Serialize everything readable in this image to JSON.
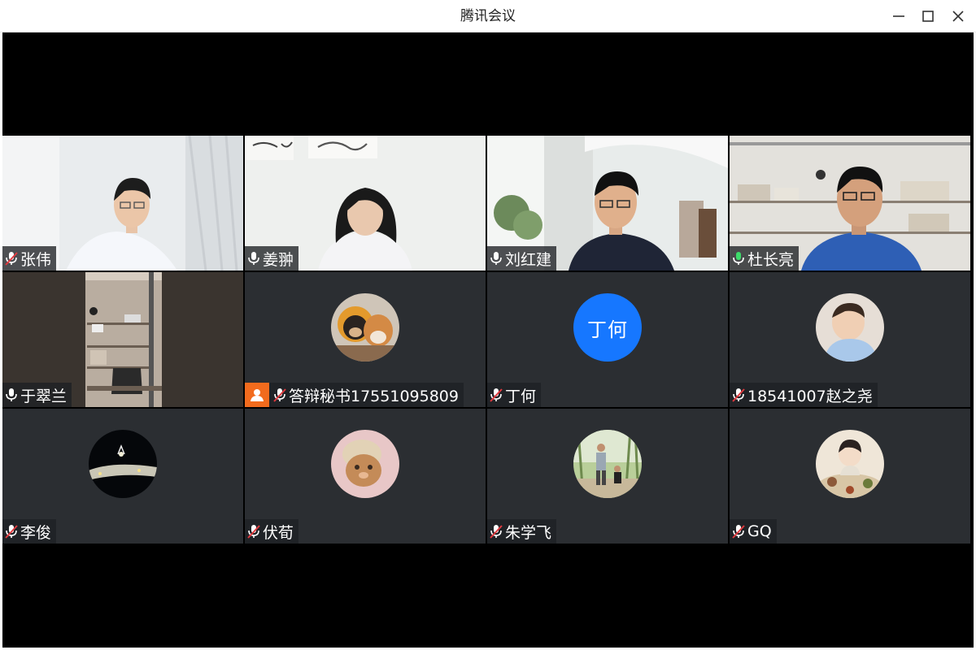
{
  "window": {
    "title": "腾讯会议"
  },
  "participants": [
    {
      "name": "张伟",
      "mic": "muted",
      "media": "video"
    },
    {
      "name": "姜翀",
      "mic": "on",
      "media": "video"
    },
    {
      "name": "刘红建",
      "mic": "on",
      "media": "video"
    },
    {
      "name": "杜长亮",
      "mic": "speaking",
      "media": "video"
    },
    {
      "name": "于翠兰",
      "mic": "on",
      "media": "video"
    },
    {
      "name": "答辩秘书17551095809",
      "mic": "muted",
      "media": "avatar",
      "host_badge": true
    },
    {
      "name": "丁何",
      "mic": "muted",
      "media": "text-avatar",
      "avatar_text": "丁何"
    },
    {
      "name": "18541007赵之尧",
      "mic": "muted",
      "media": "avatar"
    },
    {
      "name": "李俊",
      "mic": "muted",
      "media": "avatar"
    },
    {
      "name": "伏荀",
      "mic": "muted",
      "media": "avatar"
    },
    {
      "name": "朱学飞",
      "mic": "muted",
      "media": "avatar"
    },
    {
      "name": "GQ",
      "mic": "muted",
      "media": "avatar"
    }
  ],
  "colors": {
    "speaking": "#3ddc6a",
    "muted": "#e0393e",
    "text_avatar_bg": "#1677ff",
    "host_badge": "#f26b1d",
    "tile_bg": "#2b2e32"
  }
}
